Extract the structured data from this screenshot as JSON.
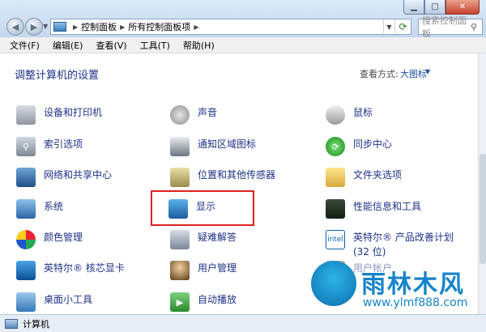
{
  "address": {
    "crumbs": [
      "控制面板",
      "所有控制面板项"
    ],
    "search_placeholder": "搜索控制面板"
  },
  "menu": [
    "文件(F)",
    "编辑(E)",
    "查看(V)",
    "工具(T)",
    "帮助(H)"
  ],
  "header": {
    "title": "调整计算机的设置",
    "view_label": "查看方式:",
    "view_value": "大图标"
  },
  "items": {
    "devices_printers": "设备和打印机",
    "sound": "声音",
    "mouse": "鼠标",
    "indexing": "索引选项",
    "notify_icons": "通知区域图标",
    "sync_center": "同步中心",
    "network_center": "网络和共享中心",
    "location_sensors": "位置和其他传感器",
    "folder_options": "文件夹选项",
    "system": "系统",
    "display": "显示",
    "performance": "性能信息和工具",
    "color_mgmt": "颜色管理",
    "troubleshoot": "疑难解答",
    "intel_program_l1": "英特尔® 产品改善计划",
    "intel_program_l2": "(32 位)",
    "intel_gfx": "英特尔® 核芯显卡",
    "user_accounts": "用户管理",
    "user_accounts_partial": "用户帐户",
    "desktop_gadgets": "桌面小工具",
    "autoplay": "自动播放"
  },
  "status": "计算机",
  "watermark": {
    "title": "雨林木风",
    "url": "www.ylmf888.com"
  }
}
